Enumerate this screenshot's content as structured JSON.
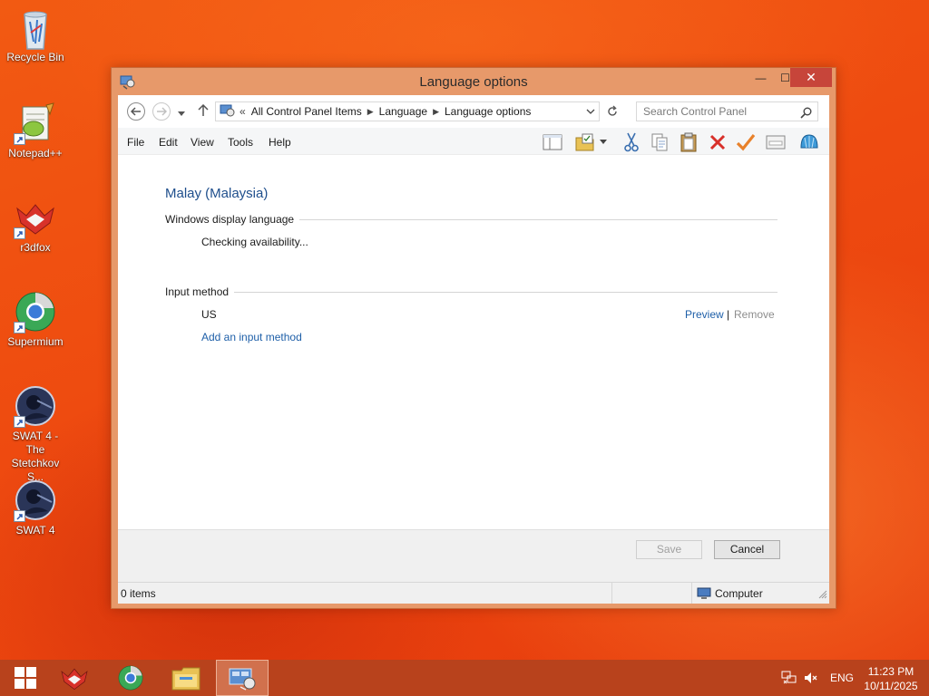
{
  "desktop": {
    "icons": [
      {
        "label": "Recycle Bin",
        "icon": "recycle-bin-icon"
      },
      {
        "label": "Notepad++",
        "icon": "notepad-plus-plus-icon"
      },
      {
        "label": "r3dfox",
        "icon": "r3dfox-icon"
      },
      {
        "label": "Supermium",
        "icon": "supermium-icon"
      },
      {
        "label": "SWAT 4 - The Stetchkov S...",
        "icon": "swat4-icon"
      },
      {
        "label": "SWAT 4",
        "icon": "swat4-icon"
      }
    ]
  },
  "window": {
    "title": "Language options",
    "controls": {
      "minimize": "—",
      "maximize": "☐",
      "close": "✕"
    },
    "address": {
      "lead": "«",
      "crumbs": [
        "All Control Panel Items",
        "Language",
        "Language options"
      ]
    },
    "search": {
      "placeholder": "Search Control Panel"
    },
    "menu": [
      "File",
      "Edit",
      "View",
      "Tools",
      "Help"
    ],
    "content": {
      "language_name": "Malay (Malaysia)",
      "display_section": "Windows display language",
      "display_status": "Checking availability...",
      "input_section": "Input method",
      "input_method": "US",
      "preview_link": "Preview",
      "link_separator": "|",
      "remove_link": "Remove",
      "add_link": "Add an input method"
    },
    "buttons": {
      "save": "Save",
      "cancel": "Cancel"
    },
    "status": {
      "count": "0 items",
      "location": "Computer"
    }
  },
  "taskbar": {
    "language": "ENG",
    "time": "11:23 PM",
    "date": "10/11/2025"
  },
  "colors": {
    "accent_link": "#1e5fa8",
    "heading": "#1e4e8c",
    "close_button": "#c7453a",
    "window_frame": "#e7996a"
  }
}
